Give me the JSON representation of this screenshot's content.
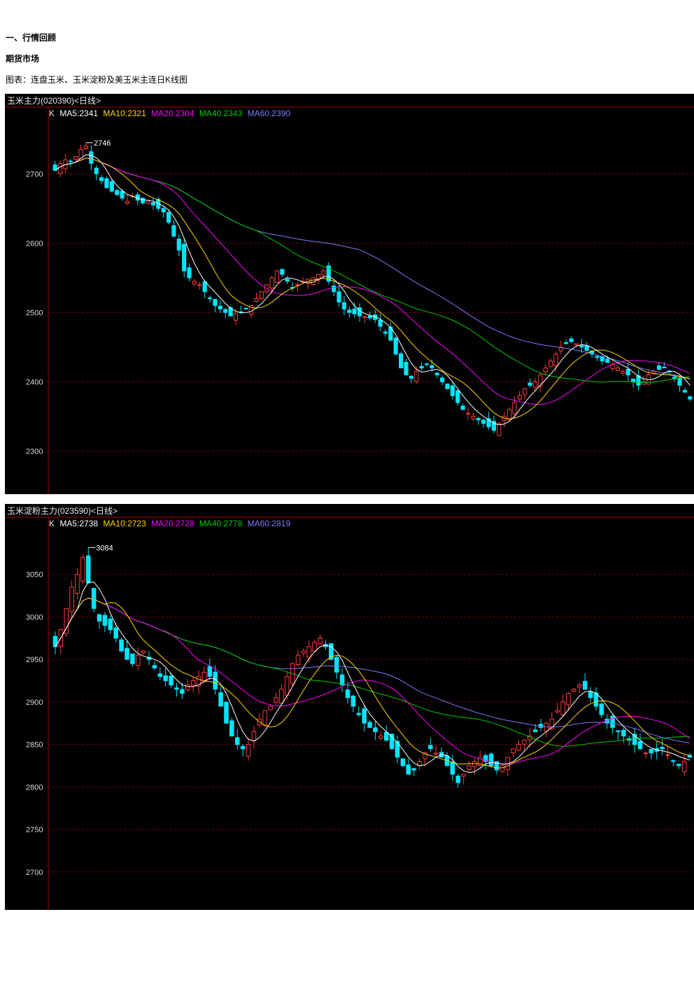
{
  "heading": "一、行情回顾",
  "subheading": "期货市场",
  "caption": "图表：连盘玉米、玉米淀粉及美玉米主连日K线图",
  "colors": {
    "up": "#ff3b3b",
    "down": "#00e5ff",
    "ma5": "#ffffff",
    "ma10": "#ffd700",
    "ma20": "#ff00ff",
    "ma40": "#00cc00",
    "ma60": "#7b7bff",
    "grid": "#7a0000",
    "axis": "#b00000"
  },
  "chart_data": [
    {
      "type": "candlestick",
      "title": "玉米主力(020390)<日线>",
      "legend_k": "K",
      "ma_labels": [
        "MA5:2341",
        "MA10:2321",
        "MA20:2304",
        "MA40:2343",
        "MA60:2390"
      ],
      "y_ticks": [
        2700,
        2600,
        2500,
        2400,
        2300
      ],
      "ylim": [
        2240,
        2775
      ],
      "high_label": "2746",
      "close": [
        2705,
        2715,
        2720,
        2718,
        2725,
        2735,
        2740,
        2715,
        2700,
        2690,
        2680,
        2675,
        2670,
        2665,
        2660,
        2668,
        2662,
        2658,
        2660,
        2655,
        2650,
        2645,
        2630,
        2610,
        2590,
        2560,
        2550,
        2545,
        2540,
        2530,
        2520,
        2510,
        2505,
        2500,
        2495,
        2498,
        2500,
        2505,
        2510,
        2520,
        2530,
        2540,
        2550,
        2560,
        2555,
        2545,
        2535,
        2540,
        2545,
        2548,
        2550,
        2555,
        2560,
        2545,
        2530,
        2515,
        2505,
        2500,
        2498,
        2495,
        2494,
        2492,
        2490,
        2480,
        2470,
        2460,
        2440,
        2420,
        2410,
        2405,
        2415,
        2420,
        2425,
        2420,
        2410,
        2400,
        2390,
        2380,
        2370,
        2360,
        2355,
        2350,
        2345,
        2340,
        2335,
        2330,
        2340,
        2350,
        2360,
        2370,
        2380,
        2390,
        2395,
        2400,
        2410,
        2420,
        2430,
        2440,
        2450,
        2455,
        2458,
        2455,
        2450,
        2445,
        2440,
        2435,
        2430,
        2428,
        2425,
        2420,
        2415,
        2410,
        2400,
        2395,
        2400,
        2410,
        2415,
        2418,
        2420,
        2415,
        2405,
        2395,
        2385,
        2375
      ]
    },
    {
      "type": "candlestick",
      "title": "玉米淀粉主力(023590)<日线>",
      "legend_k": "K",
      "ma_labels": [
        "MA5:2738",
        "MA10:2723",
        "MA20:2728",
        "MA40:2778",
        "MA60:2819"
      ],
      "y_ticks": [
        3050,
        3000,
        2950,
        2900,
        2850,
        2800,
        2750,
        2700
      ],
      "ylim": [
        2657,
        3100
      ],
      "high_label": "3084",
      "close": [
        2965,
        2985,
        3010,
        3035,
        3050,
        3070,
        3040,
        3010,
        2995,
        2990,
        2985,
        2975,
        2960,
        2950,
        2945,
        2955,
        2960,
        2950,
        2940,
        2930,
        2925,
        2920,
        2915,
        2910,
        2920,
        2925,
        2930,
        2935,
        2930,
        2915,
        2895,
        2875,
        2860,
        2850,
        2845,
        2850,
        2865,
        2880,
        2890,
        2895,
        2905,
        2915,
        2930,
        2945,
        2955,
        2960,
        2965,
        2970,
        2975,
        2965,
        2950,
        2935,
        2920,
        2905,
        2895,
        2885,
        2875,
        2870,
        2865,
        2860,
        2855,
        2845,
        2835,
        2825,
        2815,
        2820,
        2830,
        2840,
        2845,
        2840,
        2835,
        2825,
        2815,
        2805,
        2815,
        2825,
        2830,
        2835,
        2830,
        2825,
        2820,
        2825,
        2835,
        2845,
        2850,
        2855,
        2860,
        2865,
        2870,
        2875,
        2880,
        2890,
        2900,
        2910,
        2915,
        2920,
        2915,
        2905,
        2895,
        2885,
        2875,
        2870,
        2865,
        2860,
        2855,
        2850,
        2845,
        2840,
        2840,
        2842,
        2845,
        2838,
        2830,
        2825,
        2830,
        2835
      ]
    }
  ]
}
